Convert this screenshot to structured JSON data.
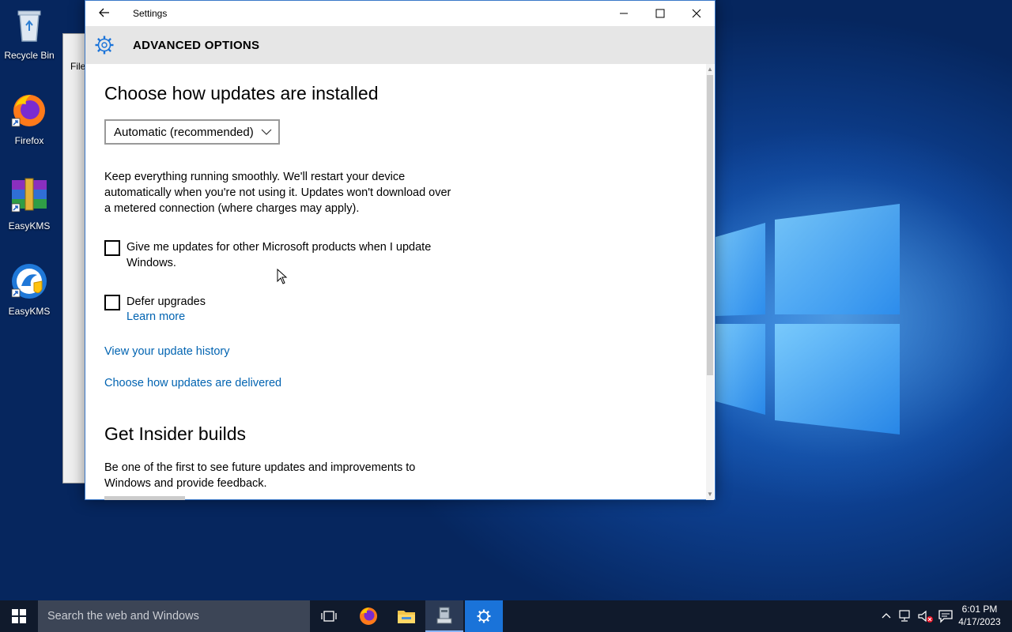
{
  "desktop": {
    "icons": [
      {
        "label": "Recycle Bin",
        "icon": "recycle-bin-icon"
      },
      {
        "label": "Firefox",
        "icon": "firefox-icon"
      },
      {
        "label": "EasyKMS",
        "icon": "winrar-icon"
      },
      {
        "label": "EasyKMS",
        "icon": "easykms-icon"
      }
    ]
  },
  "background_window": {
    "menu_label": "File"
  },
  "window": {
    "title": "Settings",
    "header": "ADVANCED OPTIONS"
  },
  "content": {
    "section1_title": "Choose how updates are installed",
    "install_option": "Automatic (recommended)",
    "description": "Keep everything running smoothly. We'll restart your device automatically when you're not using it. Updates won't download over a metered connection (where charges may apply).",
    "checkbox_ms_products": {
      "label": "Give me updates for other Microsoft products when I update Windows.",
      "checked": false
    },
    "checkbox_defer": {
      "label": "Defer upgrades",
      "checked": false
    },
    "learn_more": "Learn more",
    "view_history": "View your update history",
    "delivery": "Choose how updates are delivered",
    "section2_title": "Get Insider builds",
    "insider_description": "Be one of the first to see future updates and improvements to Windows and provide feedback."
  },
  "taskbar": {
    "search_placeholder": "Search the web and Windows",
    "time": "6:01 PM",
    "date": "4/17/2023"
  },
  "colors": {
    "link": "#0063b1",
    "accent": "#1a73d9",
    "taskbar": "#101a2c"
  }
}
